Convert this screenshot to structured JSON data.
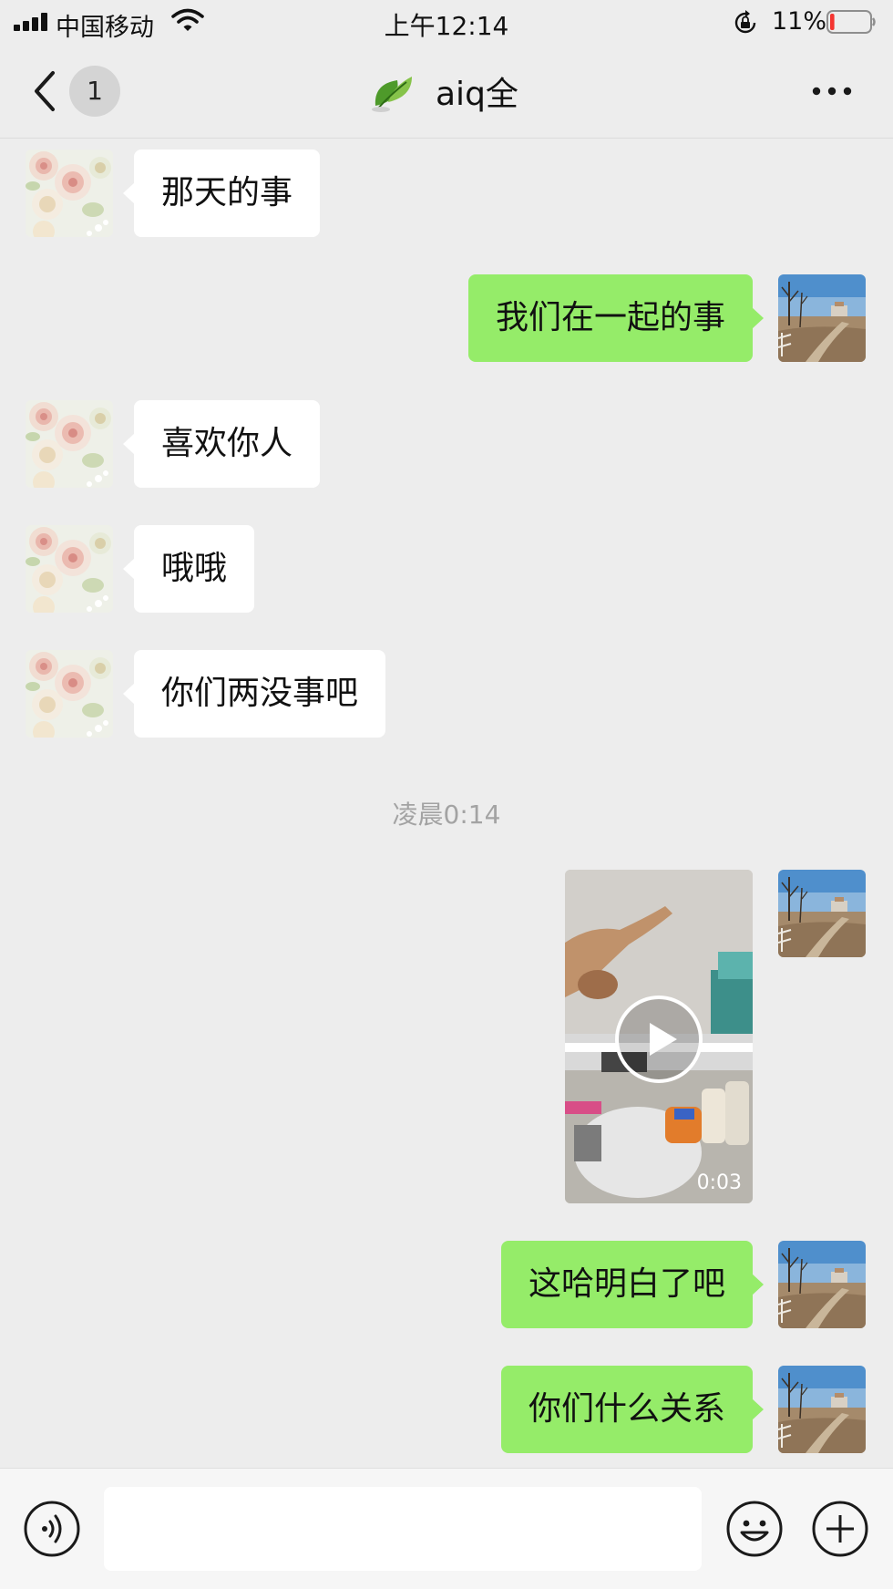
{
  "status_bar": {
    "carrier": "中国移动",
    "time": "上午12:14",
    "battery_percent": "11%",
    "battery_level": 0.11,
    "icons": [
      "signal-icon",
      "wifi-icon",
      "orientation-lock-icon",
      "battery-icon"
    ]
  },
  "nav": {
    "unread_count": "1",
    "title": "aiq全",
    "icons": [
      "back-chevron-icon",
      "leaf-icon",
      "more-dots-icon"
    ]
  },
  "messages": [
    {
      "side": "in",
      "text": "那天的事"
    },
    {
      "side": "out",
      "text": "我们在一起的事"
    },
    {
      "side": "in",
      "text": "喜欢你人"
    },
    {
      "side": "in",
      "text": "哦哦"
    },
    {
      "side": "in",
      "text": "你们两没事吧"
    },
    {
      "side": "out",
      "text": "这哈明白了吧"
    },
    {
      "side": "out",
      "text": "你们什么关系"
    }
  ],
  "timestamp": "凌晨0:14",
  "video": {
    "duration": "0:03",
    "icon": "play-icon"
  },
  "input_bar": {
    "placeholder": "",
    "icons": [
      "voice-icon",
      "emoji-icon",
      "plus-icon"
    ]
  },
  "colors": {
    "background": "#ededed",
    "outgoing_bubble": "#95ec69",
    "incoming_bubble": "#ffffff",
    "battery_low": "#f43530"
  }
}
